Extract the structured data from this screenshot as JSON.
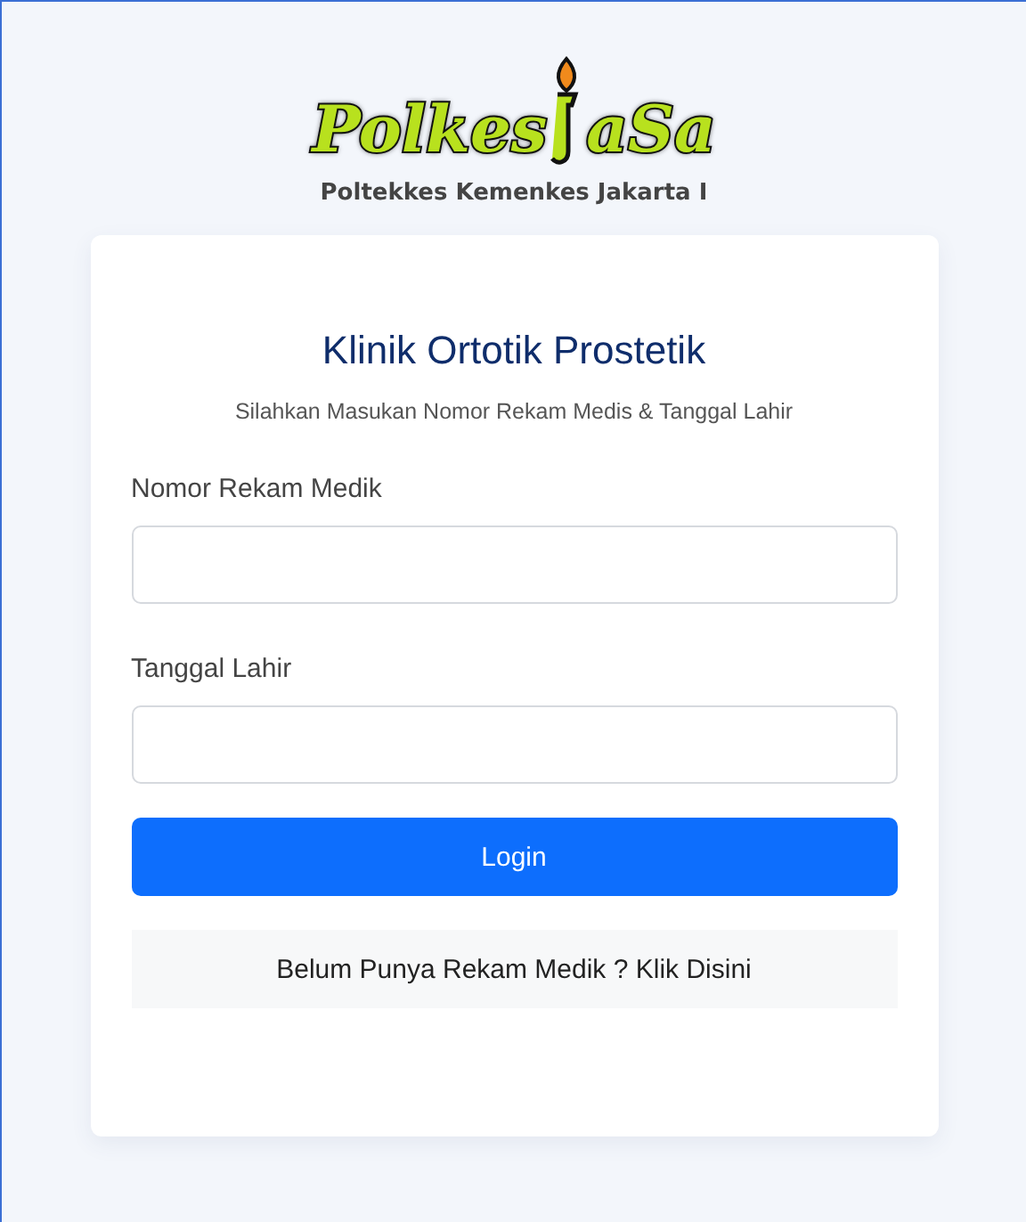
{
  "logo": {
    "left": "Polkes",
    "right": "aSa"
  },
  "institution": "Poltekkes Kemenkes Jakarta I",
  "card": {
    "title": "Klinik Ortotik Prostetik",
    "subtitle": "Silahkan Masukan Nomor Rekam Medis & Tanggal Lahir",
    "fields": [
      {
        "label": "Nomor Rekam Medik"
      },
      {
        "label": "Tanggal Lahir"
      }
    ],
    "login_button": "Login",
    "register_link": "Belum Punya Rekam Medik ? Klik Disini"
  }
}
